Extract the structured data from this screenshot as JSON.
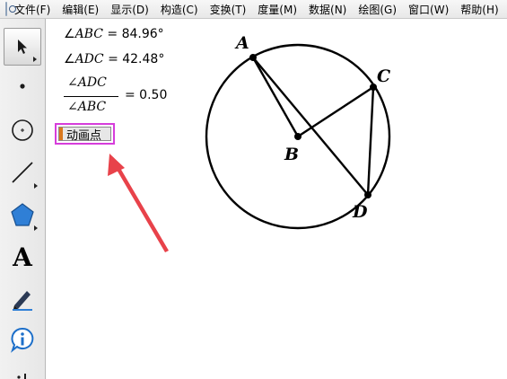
{
  "menubar": {
    "items": [
      "文件(F)",
      "编辑(E)",
      "显示(D)",
      "构造(C)",
      "变换(T)",
      "度量(M)",
      "数据(N)",
      "绘图(G)",
      "窗口(W)",
      "帮助(H)"
    ]
  },
  "toolbox": {
    "tools": [
      {
        "name": "arrow-select-tool",
        "icon": "arrow-icon"
      },
      {
        "name": "point-tool",
        "icon": "point-icon"
      },
      {
        "name": "compass-tool",
        "icon": "circle-icon"
      },
      {
        "name": "straightedge-tool",
        "icon": "line-icon"
      },
      {
        "name": "polygon-tool",
        "icon": "pentagon-icon"
      },
      {
        "name": "text-tool",
        "icon": "letter-a-icon",
        "glyph": "A"
      },
      {
        "name": "marker-tool",
        "icon": "pen-icon"
      },
      {
        "name": "information-tool",
        "icon": "info-icon"
      }
    ]
  },
  "measurements": {
    "abc": {
      "angle_symbol": "∠",
      "label": "ABC",
      "value": "= 84.96°"
    },
    "adc": {
      "angle_symbol": "∠",
      "label": "ADC",
      "value": "= 42.48°"
    },
    "ratio": {
      "numerator": "∠ADC",
      "denominator": "∠ABC",
      "value": "= 0.50"
    }
  },
  "animate_button": {
    "label": "动画点"
  },
  "diagram": {
    "point_labels": {
      "A": "A",
      "B": "B",
      "C": "C",
      "D": "D"
    },
    "arrow_color": "#e8424a",
    "highlight_color": "#d63ddb"
  }
}
